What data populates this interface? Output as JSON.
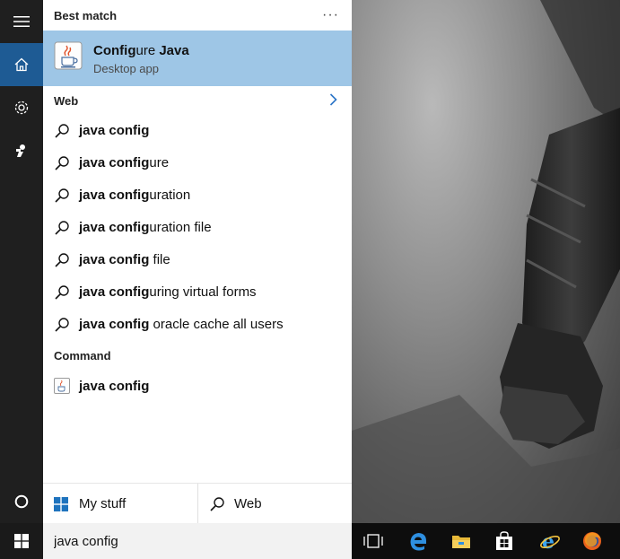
{
  "search": {
    "query": "java config"
  },
  "best_match": {
    "header": "Best match",
    "more": "···",
    "title_bold": "Config",
    "title_rest": "ure ",
    "title_bold2": "Java",
    "subtitle": "Desktop app"
  },
  "web": {
    "header": "Web",
    "suggestions": [
      {
        "bold": "java config",
        "rest": ""
      },
      {
        "bold": "java config",
        "rest": "ure"
      },
      {
        "bold": "java config",
        "rest": "uration"
      },
      {
        "bold": "java config",
        "rest": "uration file"
      },
      {
        "bold": "java config",
        "rest": " file"
      },
      {
        "bold": "java config",
        "rest": "uring virtual forms"
      },
      {
        "bold": "java config",
        "rest": " oracle cache all users"
      }
    ]
  },
  "command": {
    "header": "Command",
    "item": "java config"
  },
  "scopes": {
    "my_stuff": "My stuff",
    "web": "Web"
  },
  "rail": {
    "icons": [
      "hamburger-icon",
      "home-icon",
      "settings-icon",
      "feedback-icon",
      "cortana-icon"
    ]
  },
  "taskbar": {
    "icons": [
      "task-view-icon",
      "edge-icon",
      "file-explorer-icon",
      "store-icon",
      "internet-explorer-icon",
      "firefox-icon"
    ]
  },
  "colors": {
    "accent": "#1e5b94",
    "selection": "#9ec6e6"
  }
}
